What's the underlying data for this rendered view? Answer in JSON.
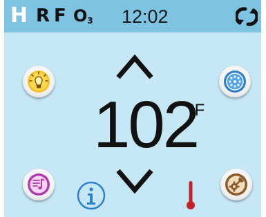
{
  "status_bar": {
    "indicators": [
      "H",
      "R",
      "F",
      "O",
      "3"
    ],
    "clock": "12:02",
    "flip_icon": "flip-screen-icon"
  },
  "temperature": {
    "value": "102",
    "unit": "°F",
    "up_icon": "chevron-up-icon",
    "down_icon": "chevron-down-icon"
  },
  "buttons": {
    "light_icon": "light-bulb-icon",
    "jets_icon": "jets-icon",
    "music_icon": "music-icon",
    "settings_icon": "settings-icon",
    "info_icon": "info-icon",
    "heater_icon": "thermometer-icon"
  },
  "colors": {
    "screen_bg": "#c6e7f5",
    "status_bar_bg": "#7fc3e2",
    "light_accent": "#f3c12a",
    "jets_accent": "#2f7fd1",
    "music_accent": "#b23bb0",
    "settings_accent": "#8a5a2b",
    "heater_accent": "#c0222a"
  }
}
